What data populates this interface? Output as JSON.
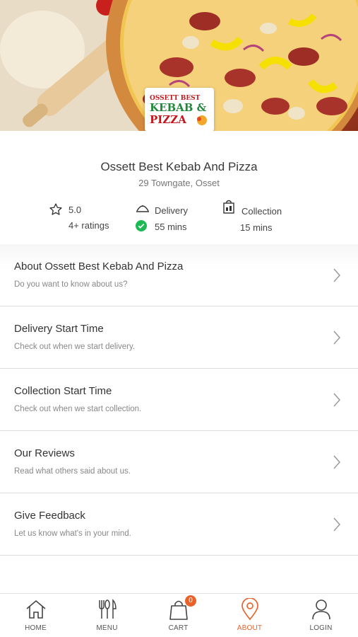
{
  "hero": {
    "image": "pizza-banner",
    "logo": {
      "line1": "OSSETT BEST",
      "line2": "KEBAB &",
      "line3": "PIZZA"
    }
  },
  "store": {
    "name": "Ossett Best Kebab And Pizza",
    "address": "29 Towngate, Osset",
    "rating": {
      "value": "5.0",
      "count": "4+ ratings"
    },
    "delivery": {
      "label": "Delivery",
      "time": "55 mins"
    },
    "collection": {
      "label": "Collection",
      "time": "15 mins"
    }
  },
  "list": [
    {
      "title": "About Ossett Best Kebab And Pizza",
      "subtitle": "Do you want to know about us?"
    },
    {
      "title": "Delivery Start Time",
      "subtitle": "Check out when we start delivery."
    },
    {
      "title": "Collection Start Time",
      "subtitle": "Check out when we start collection."
    },
    {
      "title": "Our Reviews",
      "subtitle": "Read what others said about us."
    },
    {
      "title": "Give Feedback",
      "subtitle": "Let us know what's in your mind."
    }
  ],
  "nav": {
    "items": [
      {
        "label": "HOME",
        "icon": "home-icon"
      },
      {
        "label": "MENU",
        "icon": "menu-utensils-icon"
      },
      {
        "label": "CART",
        "icon": "cart-bag-icon",
        "badge": "0"
      },
      {
        "label": "ABOUT",
        "icon": "location-pin-icon",
        "active": true
      },
      {
        "label": "LOGIN",
        "icon": "user-icon"
      }
    ]
  },
  "colors": {
    "accent": "#e8622a",
    "check": "#1db954"
  }
}
